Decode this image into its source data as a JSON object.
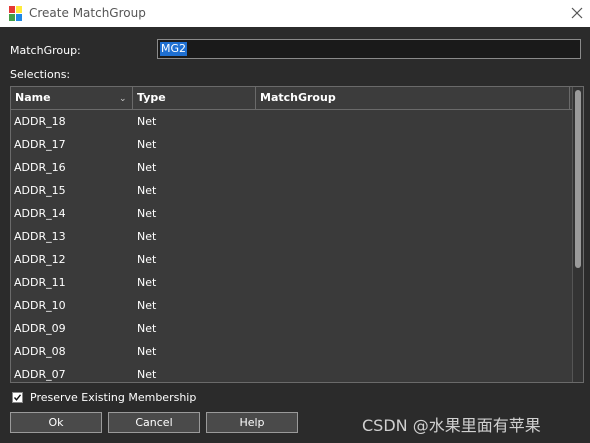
{
  "window": {
    "title": "Create MatchGroup"
  },
  "form": {
    "matchgroup_label": "MatchGroup:",
    "matchgroup_value": "MG2",
    "selections_label": "Selections:"
  },
  "table": {
    "headers": {
      "name": "Name",
      "type": "Type",
      "matchgroup": "MatchGroup"
    },
    "rows": [
      {
        "name": "ADDR_18",
        "type": "Net",
        "matchgroup": ""
      },
      {
        "name": "ADDR_17",
        "type": "Net",
        "matchgroup": ""
      },
      {
        "name": "ADDR_16",
        "type": "Net",
        "matchgroup": ""
      },
      {
        "name": "ADDR_15",
        "type": "Net",
        "matchgroup": ""
      },
      {
        "name": "ADDR_14",
        "type": "Net",
        "matchgroup": ""
      },
      {
        "name": "ADDR_13",
        "type": "Net",
        "matchgroup": ""
      },
      {
        "name": "ADDR_12",
        "type": "Net",
        "matchgroup": ""
      },
      {
        "name": "ADDR_11",
        "type": "Net",
        "matchgroup": ""
      },
      {
        "name": "ADDR_10",
        "type": "Net",
        "matchgroup": ""
      },
      {
        "name": "ADDR_09",
        "type": "Net",
        "matchgroup": ""
      },
      {
        "name": "ADDR_08",
        "type": "Net",
        "matchgroup": ""
      },
      {
        "name": "ADDR_07",
        "type": "Net",
        "matchgroup": ""
      }
    ]
  },
  "options": {
    "preserve_label": "Preserve Existing Membership",
    "preserve_checked": true
  },
  "buttons": {
    "ok": "Ok",
    "cancel": "Cancel",
    "help": "Help"
  },
  "watermark": "CSDN @水果里面有苹果",
  "colors": {
    "background": "#2b2b2b",
    "selection": "#1e6fd1",
    "titlebar": "#ffffff"
  }
}
